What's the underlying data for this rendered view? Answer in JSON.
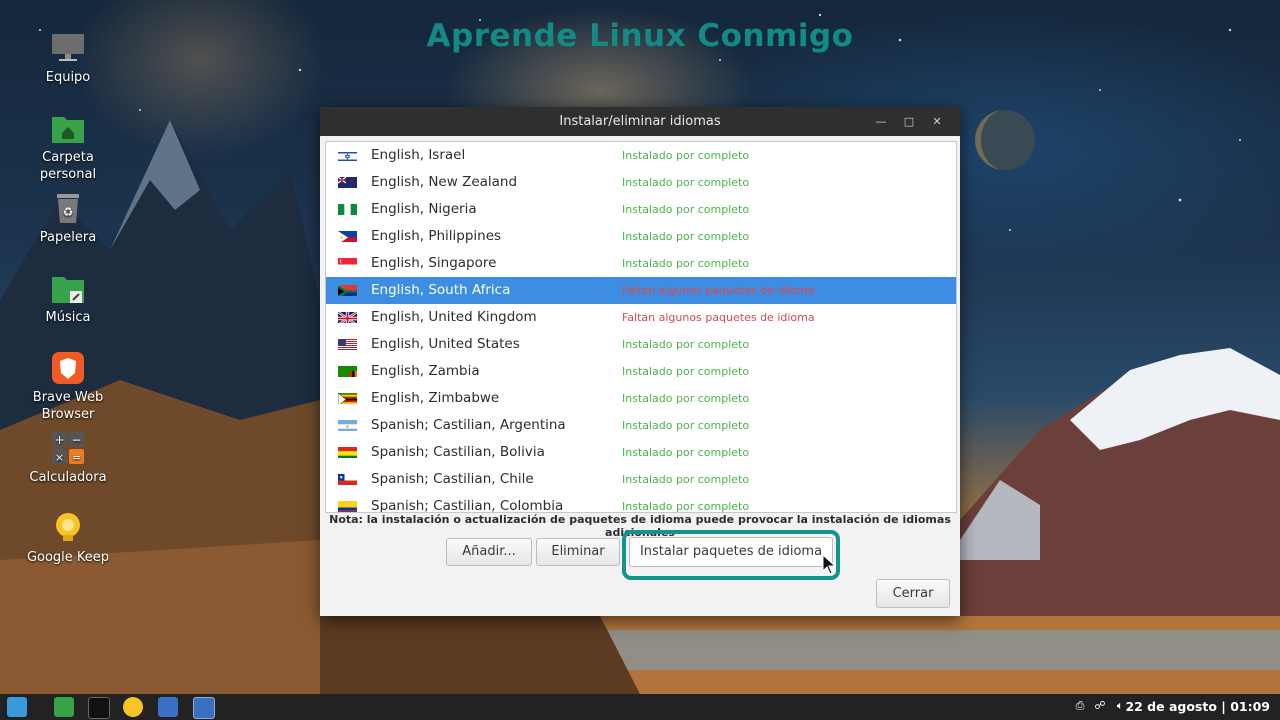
{
  "overlay_title": "Aprende Linux Conmigo",
  "desktop_icons": [
    {
      "label": "Equipo"
    },
    {
      "label": "Carpeta personal"
    },
    {
      "label": "Papelera"
    },
    {
      "label": "Música"
    },
    {
      "label": "Brave Web Browser"
    },
    {
      "label": "Calculadora"
    },
    {
      "label": "Google Keep"
    }
  ],
  "window": {
    "title": "Instalar/eliminar idiomas",
    "languages": [
      {
        "name": "English, Israel",
        "status": "Instalado por completo",
        "state": "ok"
      },
      {
        "name": "English, New Zealand",
        "status": "Instalado por completo",
        "state": "ok"
      },
      {
        "name": "English, Nigeria",
        "status": "Instalado por completo",
        "state": "ok"
      },
      {
        "name": "English, Philippines",
        "status": "Instalado por completo",
        "state": "ok"
      },
      {
        "name": "English, Singapore",
        "status": "Instalado por completo",
        "state": "ok"
      },
      {
        "name": "English, South Africa",
        "status": "Faltan algunos paquetes de idioma",
        "state": "missing",
        "selected": true
      },
      {
        "name": "English, United Kingdom",
        "status": "Faltan algunos paquetes de idioma",
        "state": "missing"
      },
      {
        "name": "English, United States",
        "status": "Instalado por completo",
        "state": "ok"
      },
      {
        "name": "English, Zambia",
        "status": "Instalado por completo",
        "state": "ok"
      },
      {
        "name": "English, Zimbabwe",
        "status": "Instalado por completo",
        "state": "ok"
      },
      {
        "name": "Spanish; Castilian, Argentina",
        "status": "Instalado por completo",
        "state": "ok"
      },
      {
        "name": "Spanish; Castilian, Bolivia",
        "status": "Instalado por completo",
        "state": "ok"
      },
      {
        "name": "Spanish; Castilian, Chile",
        "status": "Instalado por completo",
        "state": "ok"
      },
      {
        "name": "Spanish; Castilian, Colombia",
        "status": "Instalado por completo",
        "state": "ok"
      }
    ],
    "note": "Nota: la instalación o actualización de paquetes de idioma puede provocar la instalación de idiomas adicionales",
    "buttons": {
      "add": "Añadir...",
      "remove": "Eliminar",
      "install": "Instalar paquetes de idioma",
      "close": "Cerrar"
    }
  },
  "taskbar": {
    "clock": "22 de agosto | 01:09"
  },
  "colors": {
    "accent_highlight": "#12948f",
    "selection": "#3d8ee2",
    "status_ok": "#4bb24b",
    "status_missing": "#d84a4a"
  }
}
